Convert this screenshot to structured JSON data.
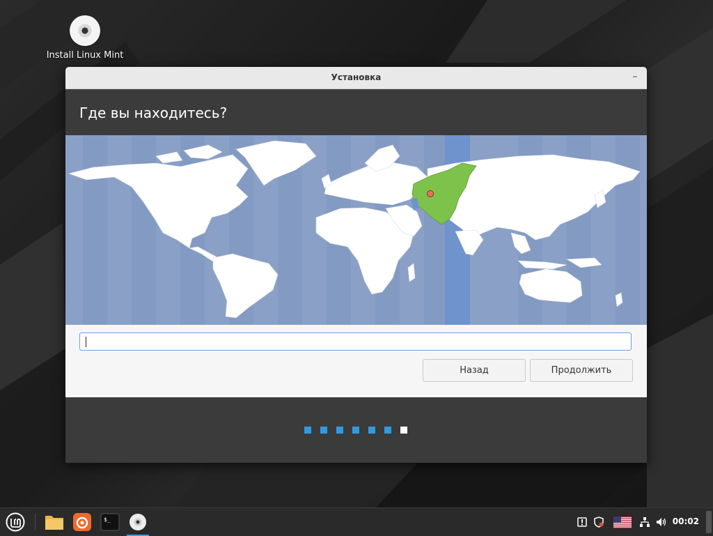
{
  "desktop": {
    "icon_label": "Install Linux Mint"
  },
  "window": {
    "title": "Установка",
    "minimize_icon": "minimize-icon",
    "heading": "Где вы находитесь?",
    "timezone_input": {
      "value": "",
      "placeholder": ""
    },
    "buttons": {
      "back": "Назад",
      "continue": "Продолжить"
    },
    "progress": {
      "total_steps": 7,
      "current_step": 7
    }
  },
  "taskbar": {
    "clock": "00:02",
    "apps": [
      "mint-menu-icon",
      "files-icon",
      "firefox-icon",
      "terminal-icon",
      "installer-disc-icon"
    ],
    "tray": [
      "notifications-icon",
      "shield-icon",
      "us-flag-icon",
      "network-icon",
      "volume-icon"
    ]
  },
  "colors": {
    "accent": "#2f9bde",
    "map_ocean": "#8aa0c6",
    "map_land": "#ffffff",
    "selected_region": "#7dc24a",
    "timezone_band": "#6e93cd"
  }
}
